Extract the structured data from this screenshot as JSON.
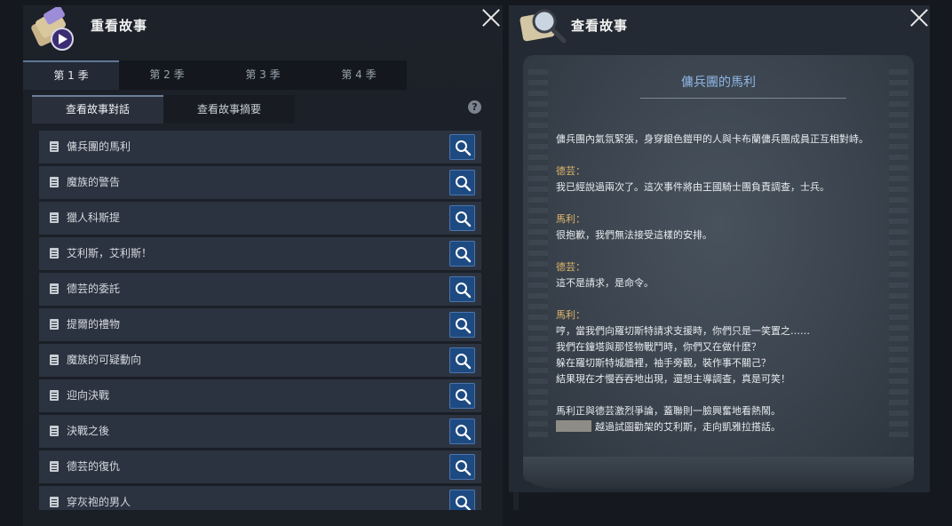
{
  "left_panel": {
    "title": "重看故事",
    "season_tabs": [
      {
        "label": "第 1 季",
        "active": true
      },
      {
        "label": "第 2 季",
        "active": false
      },
      {
        "label": "第 3 季",
        "active": false
      },
      {
        "label": "第 4 季",
        "active": false
      }
    ],
    "sub_tabs": [
      {
        "label": "查看故事對話",
        "active": true
      },
      {
        "label": "查看故事摘要",
        "active": false
      }
    ],
    "help_glyph": "?",
    "story_list": [
      "傭兵團的馬利",
      "魔族的警告",
      "獵人科斯提",
      "艾利斯，艾利斯！",
      "德芸的委託",
      "提爾的禮物",
      "魔族的可疑動向",
      "迎向決戰",
      "決戰之後",
      "德芸的復仇",
      "穿灰袍的男人"
    ]
  },
  "right_panel": {
    "title": "查看故事",
    "story_title": "傭兵團的馬利",
    "story_lines": [
      {
        "type": "text",
        "text": "傭兵團內氣氛緊張，身穿銀色鎧甲的人與卡布蘭傭兵團成員正互相對峙。"
      },
      {
        "type": "gap"
      },
      {
        "type": "speaker",
        "text": "德芸："
      },
      {
        "type": "text",
        "text": "我已經說過兩次了。這次事件將由王國騎士團負責調查，士兵。"
      },
      {
        "type": "gap"
      },
      {
        "type": "speaker",
        "text": "馬利："
      },
      {
        "type": "text",
        "text": "很抱歉，我們無法接受這樣的安排。"
      },
      {
        "type": "gap"
      },
      {
        "type": "speaker",
        "text": "德芸："
      },
      {
        "type": "text",
        "text": "這不是請求，是命令。"
      },
      {
        "type": "gap"
      },
      {
        "type": "speaker",
        "text": "馬利："
      },
      {
        "type": "text",
        "text": "哼，當我們向羅切斯特請求支援時，你們只是一笑置之……"
      },
      {
        "type": "text",
        "text": "我們在鐘塔與那怪物戰鬥時，你們又在做什麼？"
      },
      {
        "type": "text",
        "text": "躲在羅切斯特城牆裡，袖手旁觀，裝作事不關己？"
      },
      {
        "type": "text",
        "text": "結果現在才慢吞吞地出現，還想主導調查，真是可笑！"
      },
      {
        "type": "gap"
      },
      {
        "type": "text",
        "text": "馬利正與德芸激烈爭論，蓋聯則一臉興奮地看熱鬧。"
      },
      {
        "type": "blurred",
        "text": "越過試圖勸架的艾利斯，走向凱雅拉搭話。"
      }
    ]
  },
  "colors": {
    "speaker": "#e0b56b",
    "story_title": "#8fb7e6",
    "magnify_button": "#1e4a82"
  }
}
